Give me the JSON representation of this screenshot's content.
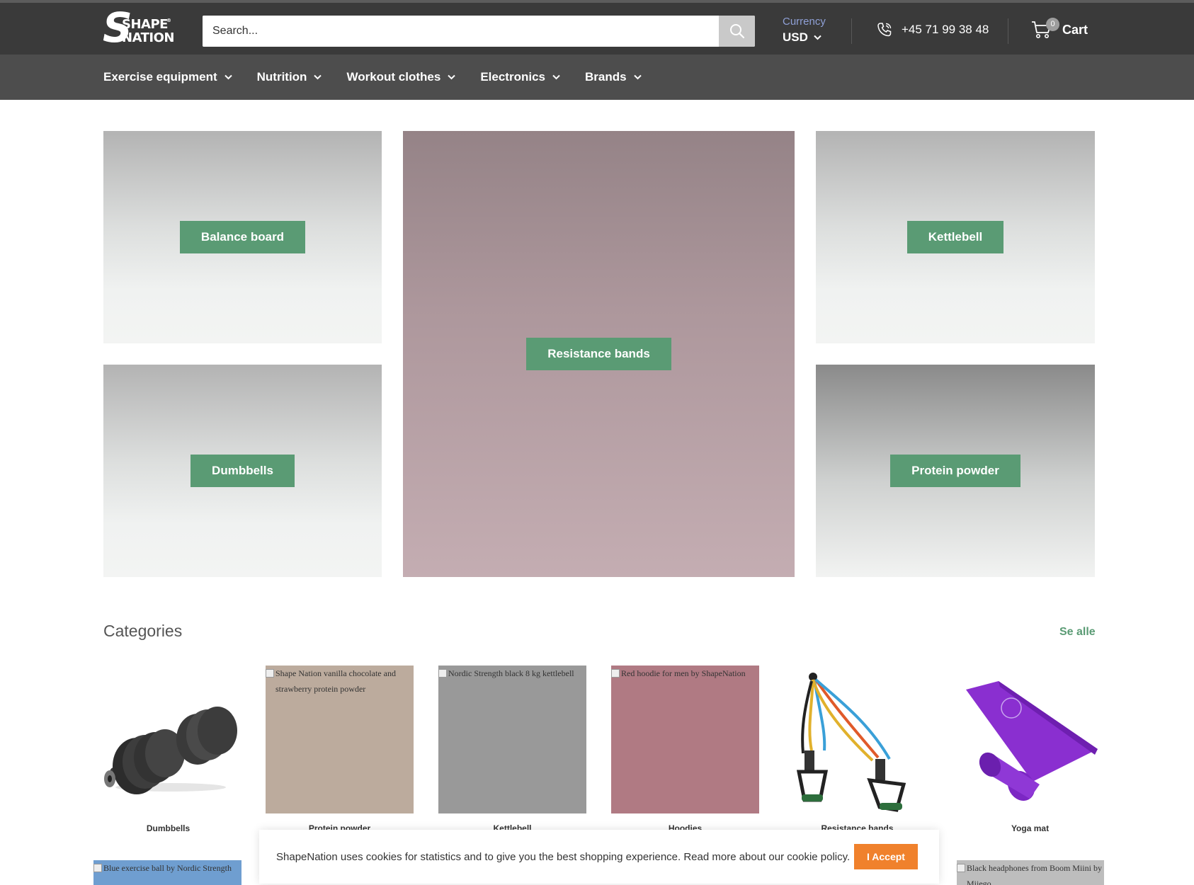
{
  "header": {
    "logo": {
      "line1": "SHAPE",
      "line2": "NATION",
      "reg": "®"
    },
    "search": {
      "placeholder": "Search..."
    },
    "currency": {
      "label": "Currency",
      "value": "USD"
    },
    "phone": "+45 71 99 38 48",
    "cart": {
      "label": "Cart",
      "count": "0"
    }
  },
  "nav": {
    "items": [
      {
        "label": "Exercise equipment"
      },
      {
        "label": "Nutrition"
      },
      {
        "label": "Workout clothes"
      },
      {
        "label": "Electronics"
      },
      {
        "label": "Brands"
      }
    ]
  },
  "hero": {
    "tiles": [
      {
        "label": "Balance board"
      },
      {
        "label": "Resistance bands"
      },
      {
        "label": "Kettlebell"
      },
      {
        "label": "Dumbbells"
      },
      {
        "label": "Protein powder"
      }
    ]
  },
  "categories": {
    "title": "Categories",
    "see_all": "Se alle",
    "items": [
      {
        "name": "Dumbbells",
        "alt": ""
      },
      {
        "name": "Protein powder",
        "alt": "Shape Nation vanilla chocolate and strawberry protein powder"
      },
      {
        "name": "Kettlebell",
        "alt": "Nordic Strength black 8 kg kettlebell"
      },
      {
        "name": "Hoodies",
        "alt": "Red hoodie for men by ShapeNation"
      },
      {
        "name": "Resistance bands",
        "alt": ""
      },
      {
        "name": "Yoga mat",
        "alt": ""
      }
    ],
    "row2": [
      {
        "alt": "Blue exercise ball by Nordic Strength"
      },
      {
        "alt": "Black headphones from Boom Miini by Miiego"
      }
    ]
  },
  "cookie": {
    "text": "ShapeNation uses cookies for statistics and to give you the best shopping experience. Read more about our cookie policy.",
    "accept": "I Accept"
  },
  "colors": {
    "header_bg": "#3a3a3a",
    "nav_bg": "#4d4d4d",
    "accent_green": "#5a9b74",
    "accept_orange": "#f0812c",
    "currency_label": "#8fa0d6"
  }
}
